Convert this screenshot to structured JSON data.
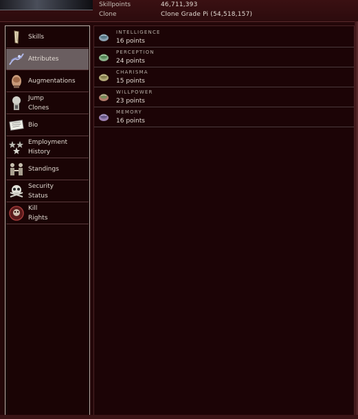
{
  "header": {
    "skillpoints_label": "Skillpoints",
    "skillpoints_value": "46,711,393",
    "clone_label": "Clone",
    "clone_value": "Clone Grade Pi (54,518,157)"
  },
  "sidebar": {
    "items": [
      {
        "lines": [
          "Skills"
        ],
        "icon": "skills-icon",
        "selected": false
      },
      {
        "lines": [
          "Attributes"
        ],
        "icon": "attributes-icon",
        "selected": true
      },
      {
        "lines": [
          "Augmentations"
        ],
        "icon": "augmentations-icon",
        "selected": false
      },
      {
        "lines": [
          "Jump",
          "Clones"
        ],
        "icon": "jump-clones-icon",
        "selected": false
      },
      {
        "lines": [
          "Bio"
        ],
        "icon": "bio-icon",
        "selected": false
      },
      {
        "lines": [
          "Employment",
          "History"
        ],
        "icon": "employment-history-icon",
        "selected": false
      },
      {
        "lines": [
          "Standings"
        ],
        "icon": "standings-icon",
        "selected": false
      },
      {
        "lines": [
          "Security",
          "Status"
        ],
        "icon": "security-status-icon",
        "selected": false
      },
      {
        "lines": [
          "Kill",
          "Rights"
        ],
        "icon": "kill-rights-icon",
        "selected": false
      }
    ]
  },
  "attributes": [
    {
      "name": "INTELLIGENCE",
      "points": "16 points",
      "icon": "intelligence-icon",
      "color": "#6a8aa0"
    },
    {
      "name": "PERCEPTION",
      "points": "24 points",
      "icon": "perception-icon",
      "color": "#7a9a6a"
    },
    {
      "name": "CHARISMA",
      "points": "15 points",
      "icon": "charisma-icon",
      "color": "#a09a5a"
    },
    {
      "name": "WILLPOWER",
      "points": "23 points",
      "icon": "willpower-icon",
      "color": "#a05a4a"
    },
    {
      "name": "MEMORY",
      "points": "16 points",
      "icon": "memory-icon",
      "color": "#8a6aa0"
    }
  ]
}
